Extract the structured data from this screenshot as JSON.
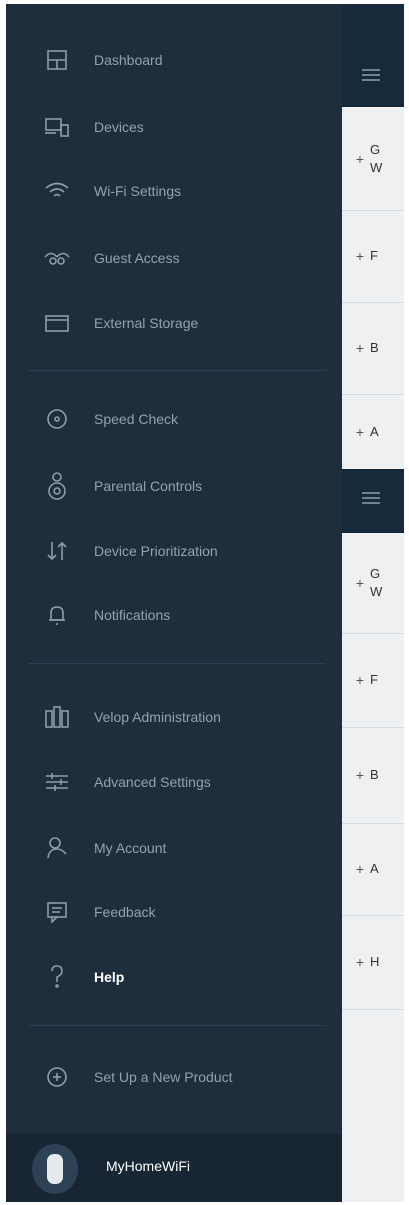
{
  "sidebar": {
    "items": [
      {
        "label": "Dashboard",
        "icon": "dashboard-icon"
      },
      {
        "label": "Devices",
        "icon": "devices-icon"
      },
      {
        "label": "Wi-Fi Settings",
        "icon": "wifi-icon"
      },
      {
        "label": "Guest Access",
        "icon": "guest-access-icon"
      },
      {
        "label": "External Storage",
        "icon": "external-storage-icon"
      },
      {
        "label": "Speed Check",
        "icon": "speed-check-icon"
      },
      {
        "label": "Parental Controls",
        "icon": "parental-controls-icon"
      },
      {
        "label": "Device Prioritization",
        "icon": "device-prioritization-icon"
      },
      {
        "label": "Notifications",
        "icon": "bell-icon"
      },
      {
        "label": "Velop Administration",
        "icon": "velop-admin-icon"
      },
      {
        "label": "Advanced Settings",
        "icon": "sliders-icon"
      },
      {
        "label": "My Account",
        "icon": "user-icon"
      },
      {
        "label": "Feedback",
        "icon": "feedback-icon"
      },
      {
        "label": "Help",
        "icon": "help-icon",
        "active": true
      },
      {
        "label": "Set Up a New Product",
        "icon": "plus-circle-icon"
      }
    ],
    "network_name": "MyHomeWiFi"
  },
  "main": {
    "top_rows": [
      {
        "text": "G\nW"
      },
      {
        "text": "F"
      },
      {
        "text": "B"
      },
      {
        "text": "A"
      }
    ],
    "bottom_rows": [
      {
        "text": "G\nW"
      },
      {
        "text": "F"
      },
      {
        "text": "B"
      },
      {
        "text": "A"
      },
      {
        "text": "H"
      }
    ],
    "plus_symbol": "+"
  },
  "colors": {
    "sidebar_bg": "#1f2e3c",
    "header_bg": "#162a3b",
    "label": "#93a2b0",
    "active_label": "#ffffff"
  }
}
